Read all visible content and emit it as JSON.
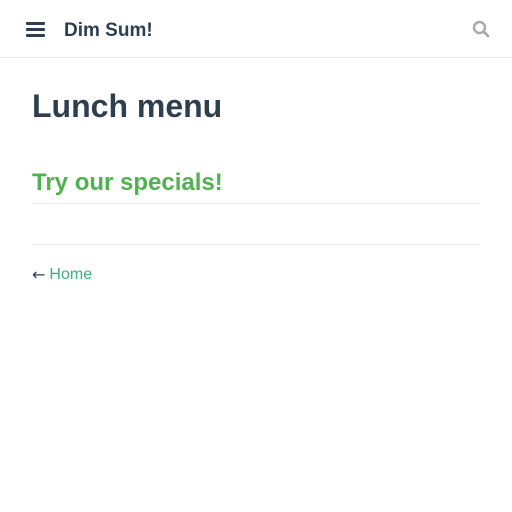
{
  "navbar": {
    "menu_icon": "hamburger-menu-icon",
    "site_title": "Dim Sum!",
    "search_icon": "search-icon"
  },
  "page": {
    "title": "Lunch menu",
    "specials_heading": "Try our specials!"
  },
  "footer_nav": {
    "back_arrow": "←",
    "back_icon": "arrow-left-icon",
    "home_label": "Home"
  },
  "colors": {
    "text": "#2c3e50",
    "heading_green": "#4fb24f",
    "link_green": "#3eaf7c",
    "divider": "#eaecef"
  }
}
